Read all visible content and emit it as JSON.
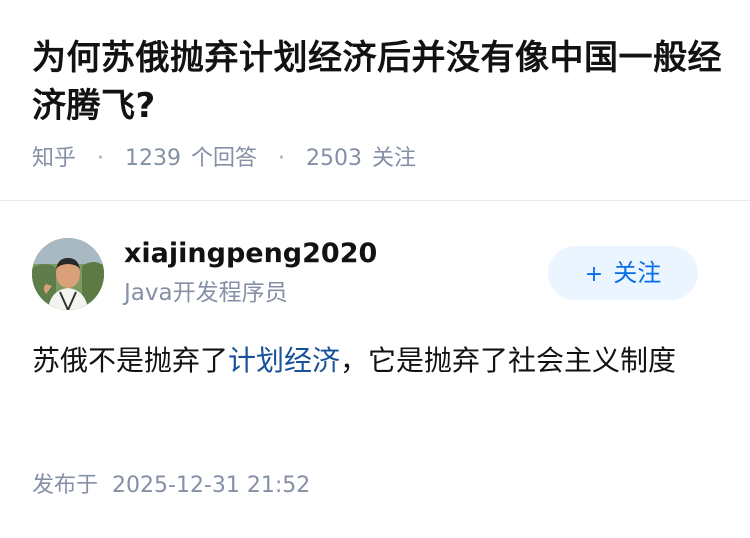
{
  "question": {
    "title": "为何苏俄抛弃计划经济后并没有像中国一般经济腾飞?",
    "source": "知乎",
    "separator": "·",
    "answer_count": "1239",
    "answer_label": "个回答",
    "follower_count": "2503",
    "follower_label": "关注"
  },
  "author": {
    "name": "xiajingpeng2020",
    "bio": "Java开发程序员",
    "avatar": "avatar-photo"
  },
  "follow_button": {
    "icon": "+",
    "label": "关注"
  },
  "answer": {
    "text_before": "苏俄不是抛弃了",
    "link_text": "计划经济",
    "text_after": "，它是抛弃了社会主义制度"
  },
  "publish": {
    "label": "发布于",
    "time": "2025-12-31 21:52"
  },
  "colors": {
    "title": "#121212",
    "meta": "#8590a6",
    "link": "#175199",
    "follow_bg": "#ebf5ff",
    "follow_text": "#056de8"
  }
}
